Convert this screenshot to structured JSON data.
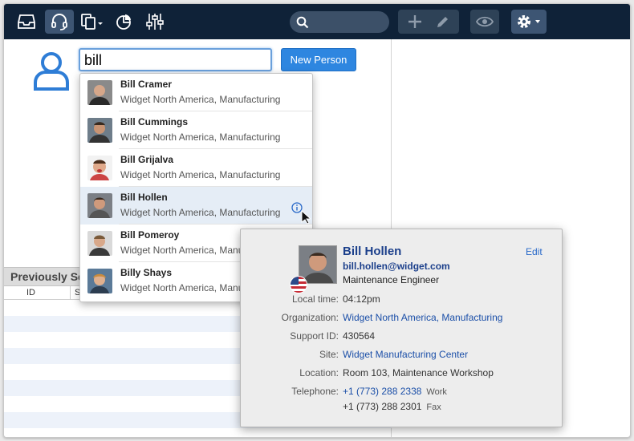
{
  "colors": {
    "toolbar_bg": "#0f2238",
    "accent": "#2e86e0",
    "link": "#1b4fa8",
    "highlight_row": "#e5edf6"
  },
  "toolbar": {
    "icons": [
      "inbox-icon",
      "headset-icon",
      "copy-dropdown-icon",
      "pie-chart-icon",
      "sliders-icon",
      "search-icon",
      "plus-icon",
      "pencil-icon",
      "eye-icon",
      "gear-dropdown-icon"
    ]
  },
  "search": {
    "value": "bill"
  },
  "new_person_label": "New Person",
  "previous_section": {
    "title": "Previously Se",
    "columns": [
      "ID",
      "S"
    ]
  },
  "dropdown": {
    "results": [
      {
        "name": "Bill Cramer",
        "org": "Widget North America, Manufacturing"
      },
      {
        "name": "Bill Cummings",
        "org": "Widget North America, Manufacturing"
      },
      {
        "name": "Bill Grijalva",
        "org": "Widget North America, Manufacturing"
      },
      {
        "name": "Bill Hollen",
        "org": "Widget North America, Manufacturing"
      },
      {
        "name": "Bill Pomeroy",
        "org": "Widget North America, Manufacturing"
      },
      {
        "name": "Billy Shays",
        "org": "Widget North America, Manufacturing"
      }
    ]
  },
  "card": {
    "name": "Bill Hollen",
    "email": "bill.hollen@widget.com",
    "job_title": "Maintenance Engineer",
    "edit_label": "Edit",
    "fields": {
      "local_time": {
        "label": "Local time:",
        "value": "04:12pm"
      },
      "organization": {
        "label": "Organization:",
        "value": "Widget North America, Manufacturing"
      },
      "support_id": {
        "label": "Support ID:",
        "value": "430564"
      },
      "site": {
        "label": "Site:",
        "value": "Widget Manufacturing Center"
      },
      "location": {
        "label": "Location:",
        "value": "Room 103, Maintenance Workshop"
      },
      "telephone": {
        "label": "Telephone:",
        "work": "+1 (773) 288 2338",
        "work_label": "Work",
        "fax": "+1 (773) 288 2301",
        "fax_label": "Fax"
      }
    }
  }
}
